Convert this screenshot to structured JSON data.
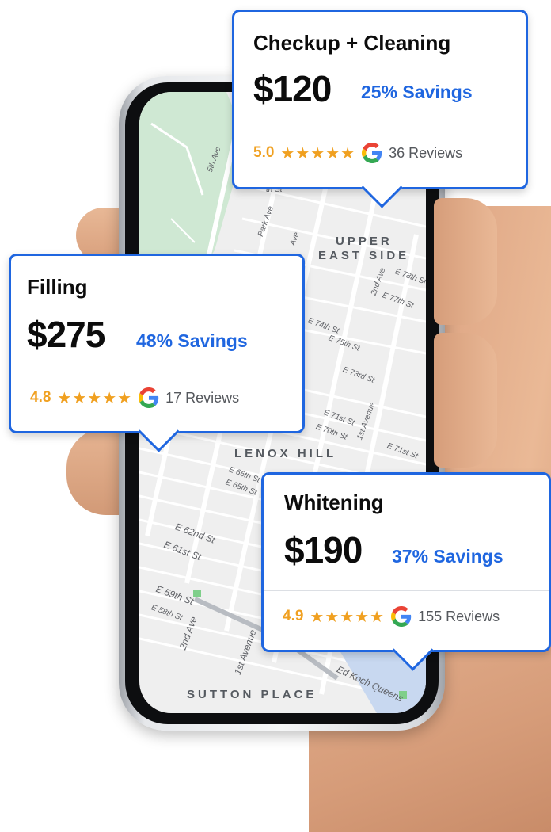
{
  "map": {
    "neighborhoods": [
      "UPPER",
      "EAST SIDE",
      "LENOX HILL",
      "SUTTON PLACE"
    ],
    "streets": [
      "5th Ave",
      "Park Ave",
      "2nd Ave",
      "1st Ave",
      "E 78th St",
      "E 77th St",
      "E 74th St",
      "E 75th St",
      "E 73rd St",
      "E 71st St",
      "E 70th St",
      "1st Avenue",
      "E 66th St",
      "E 65th St",
      "E 62nd St",
      "E 61st St",
      "E 59th St",
      "E 58th St",
      "1st Avenue",
      "Ed Koch Queens",
      "th St",
      "Ave"
    ]
  },
  "cards": [
    {
      "service": "Checkup + Cleaning",
      "price": "$120",
      "savings": "25% Savings",
      "rating": "5.0",
      "stars": "★★★★★",
      "reviews": "36 Reviews"
    },
    {
      "service": "Filling",
      "price": "$275",
      "savings": "48% Savings",
      "rating": "4.8",
      "stars": "★★★★★",
      "reviews": "17 Reviews"
    },
    {
      "service": "Whitening",
      "price": "$190",
      "savings": "37% Savings",
      "rating": "4.9",
      "stars": "★★★★★",
      "reviews": "155 Reviews"
    }
  ],
  "colors": {
    "accent": "#1f66e0",
    "star": "#f0a020",
    "google_blue": "#4285F4",
    "google_red": "#EA4335",
    "google_yellow": "#FBBC05",
    "google_green": "#34A853"
  },
  "icons": {
    "google": "google-g-icon",
    "star": "star-icon"
  }
}
